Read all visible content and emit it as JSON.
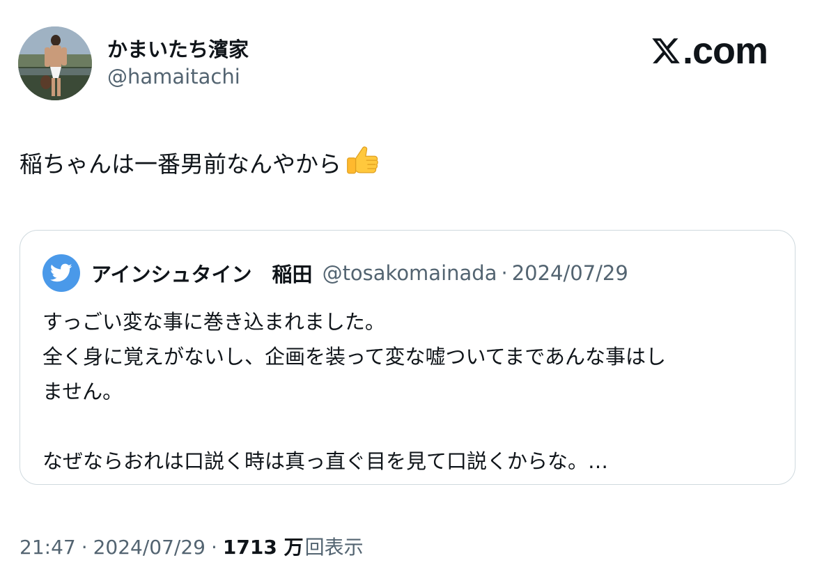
{
  "author": {
    "display_name": "かまいたち濱家",
    "handle": "@hamaitachi"
  },
  "brand": {
    "label": ".com"
  },
  "tweet": {
    "text": "稲ちゃんは一番男前なんやから",
    "emoji": "thumbs-up-icon"
  },
  "quote": {
    "author_name": "アインシュタイン　稲田",
    "handle": "@tosakomainada",
    "separator": "·",
    "date": "2024/07/29",
    "lines": [
      "すっごい変な事に巻き込まれました。",
      "全く身に覚えがないし、企画を装って変な嘘ついてまであんな事はし",
      "ません。",
      "",
      "なぜならおれは口説く時は真っ直ぐ目を見て口説くからな。…"
    ]
  },
  "footer": {
    "time": "21:47",
    "sep1": "·",
    "date": "2024/07/29",
    "sep2": "·",
    "views_count": "1713 万",
    "views_label": "回表示"
  },
  "colors": {
    "text_primary": "#0f1419",
    "text_secondary": "#536471",
    "border": "#cfd9de",
    "quote_avatar": "#4a99e9"
  }
}
